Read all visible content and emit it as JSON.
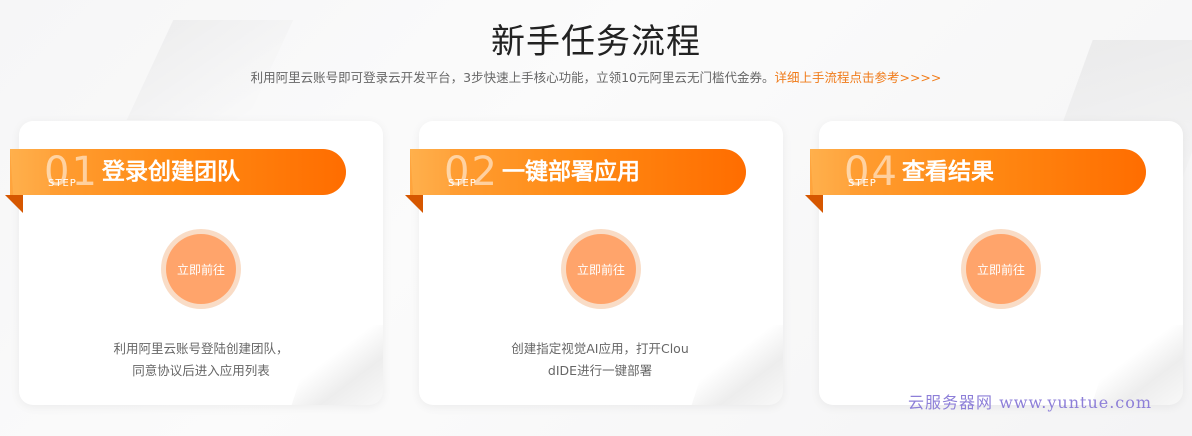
{
  "header": {
    "title": "新手任务流程",
    "subtitle": "利用阿里云账号即可登录云开发平台，3步快速上手核心功能，立领10元阿里云无门槛代金券。",
    "link_label": "详细上手流程点击参考>>>>"
  },
  "steps": [
    {
      "number": "01",
      "step_word": "STEP",
      "title": "登录创建团队",
      "button_label": "立即前往",
      "description_line1": "利用阿里云账号登陆创建团队，",
      "description_line2": "同意协议后进入应用列表"
    },
    {
      "number": "02",
      "step_word": "STEP",
      "title": "一键部署应用",
      "button_label": "立即前往",
      "description_line1": "创建指定视觉AI应用，打开Clou",
      "description_line2": "dIDE进行一键部署"
    },
    {
      "number": "04",
      "step_word": "STEP",
      "title": "查看结果",
      "button_label": "立即前往",
      "description_line1": "",
      "description_line2": ""
    }
  ],
  "watermark": "云服务器网 www.yuntue.com",
  "colors": {
    "accent": "#ff8a14",
    "link": "#f07c1b",
    "button": "#ffa46b",
    "button_ring": "#f9dcc6"
  }
}
